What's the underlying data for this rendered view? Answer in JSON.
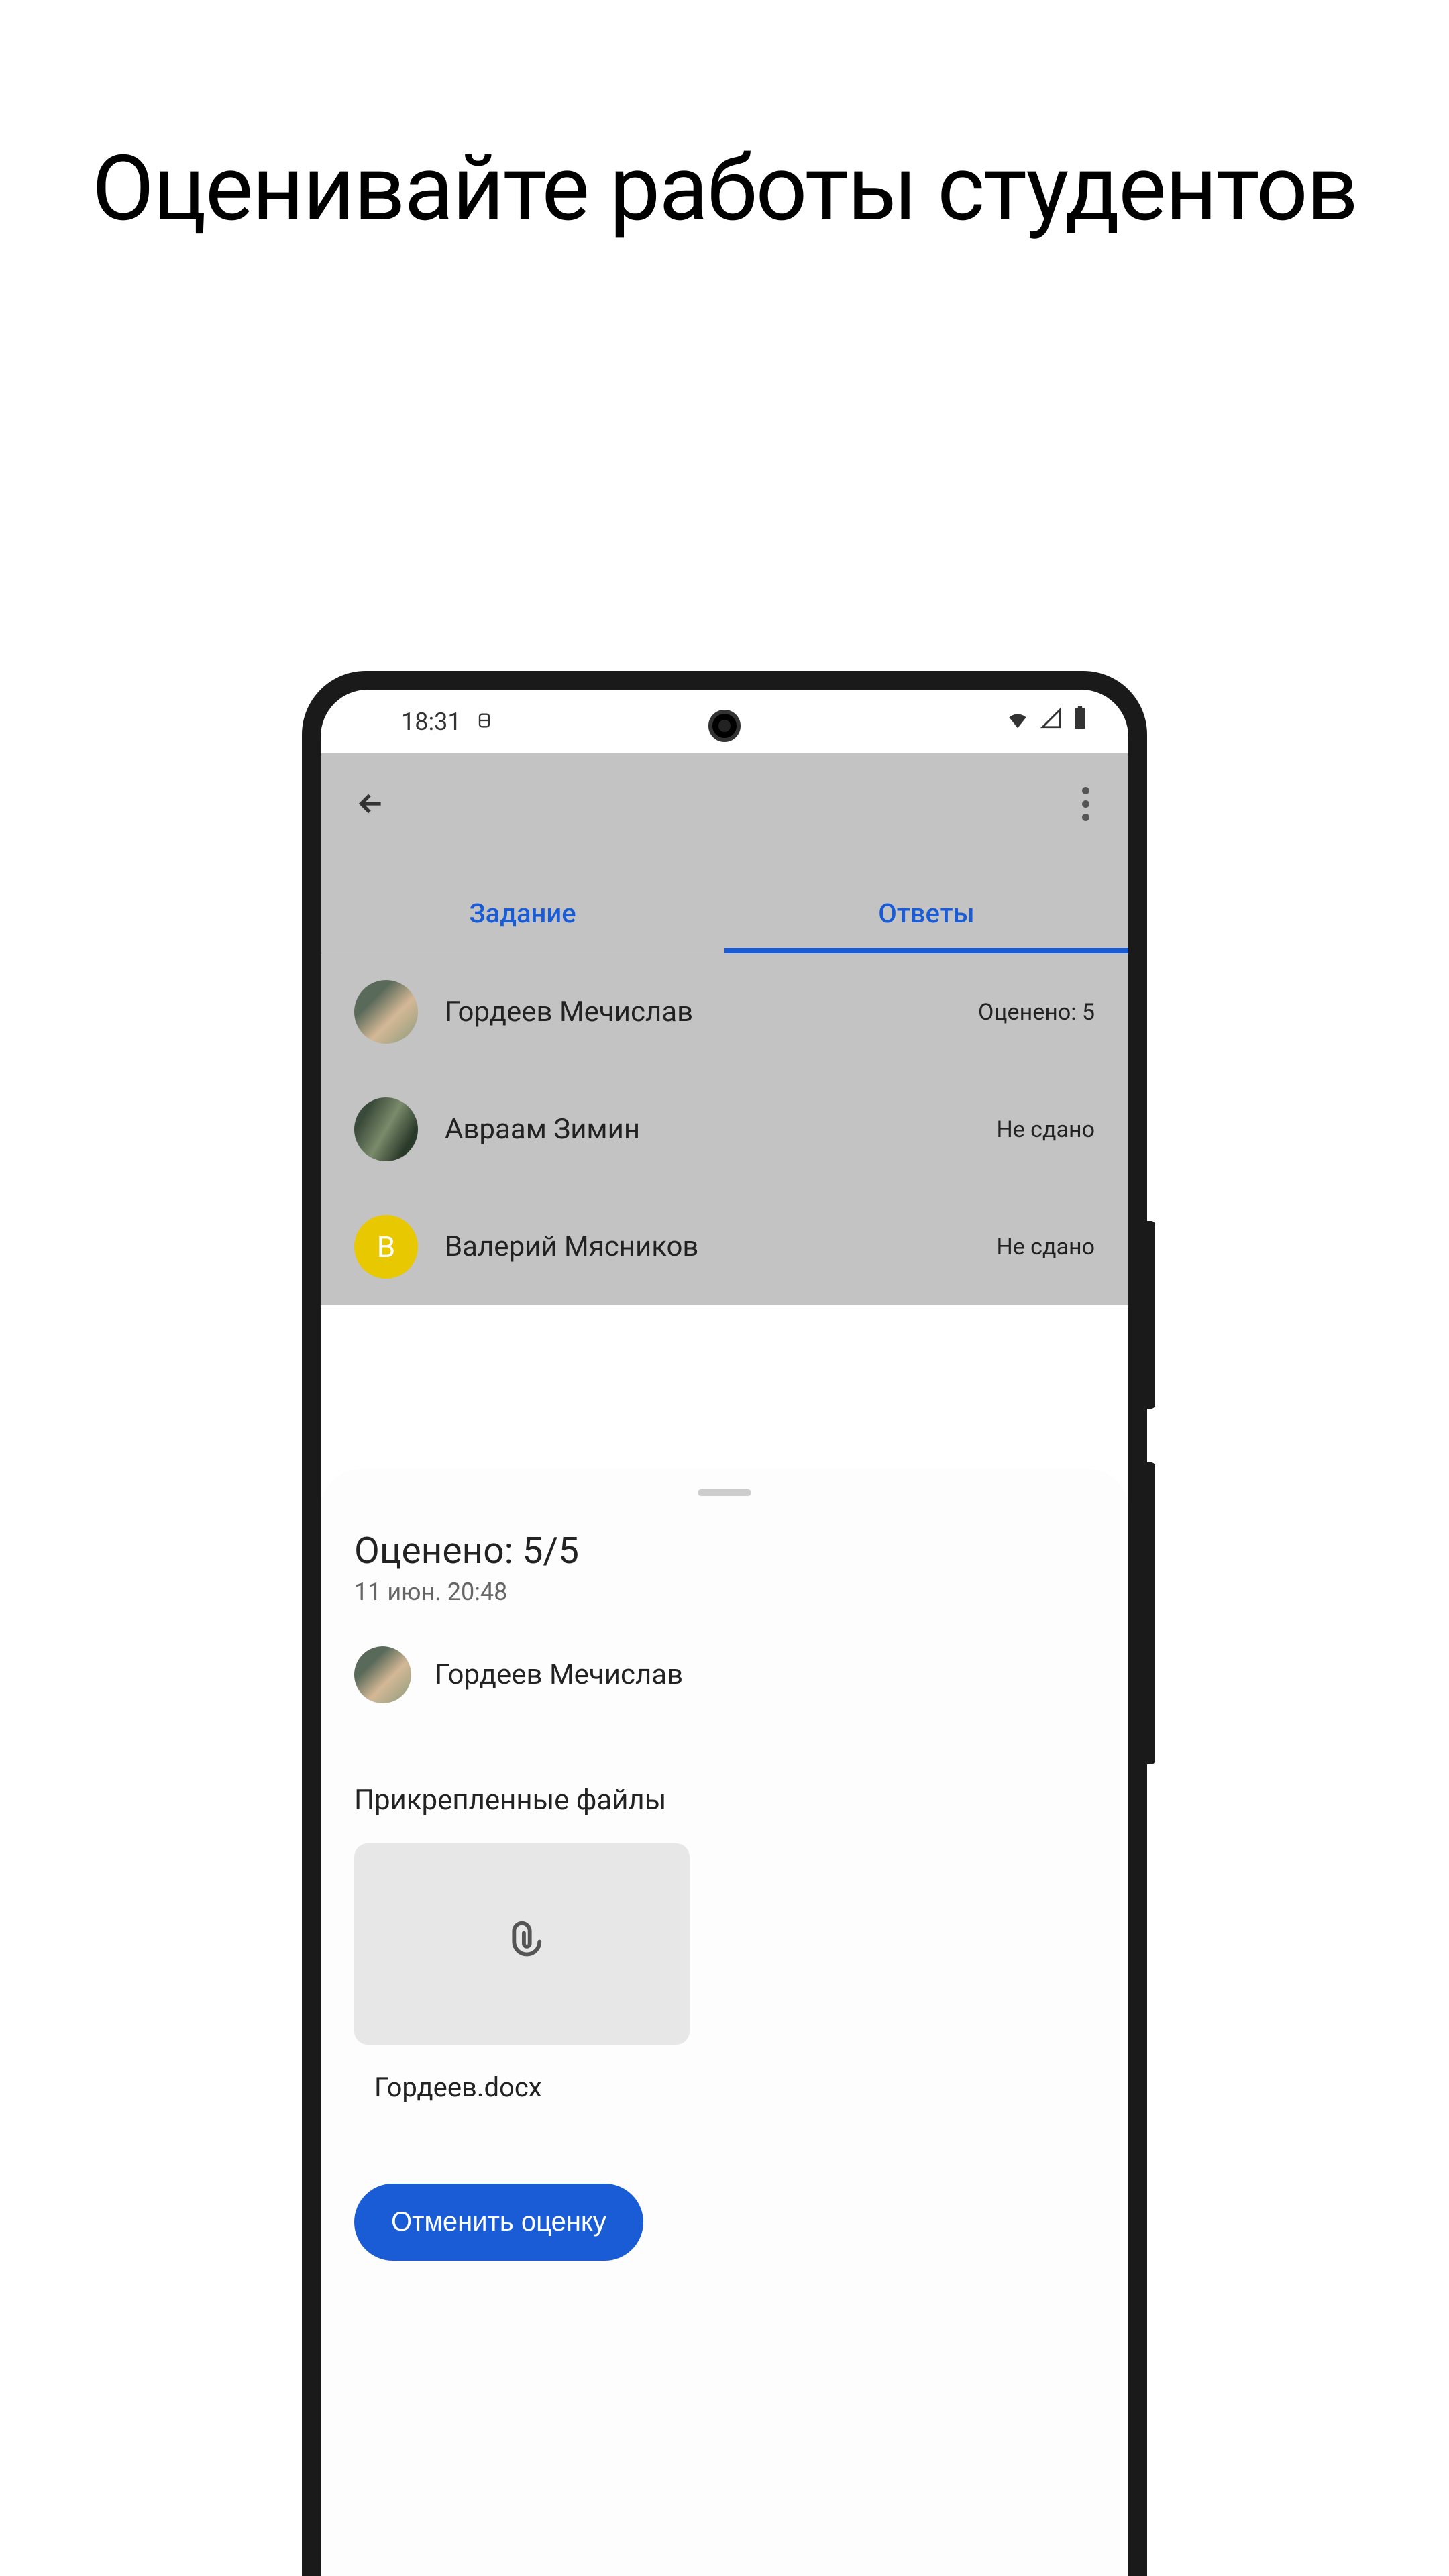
{
  "promo": {
    "title": "Оценивайте работы студентов"
  },
  "statusBar": {
    "time": "18:31"
  },
  "tabs": {
    "assignment": "Задание",
    "answers": "Ответы"
  },
  "students": [
    {
      "name": "Гордеев Мечислав",
      "status": "Оценено: 5",
      "avatarType": "img1"
    },
    {
      "name": "Авраам Зимин",
      "status": "Не сдано",
      "avatarType": "img2"
    },
    {
      "name": "Валерий Мясников",
      "status": "Не сдано",
      "avatarType": "letter",
      "letter": "В"
    }
  ],
  "sheet": {
    "title": "Оценено: 5/5",
    "date": "11 июн. 20:48",
    "studentName": "Гордеев Мечислав",
    "attachmentsLabel": "Прикрепленные файлы",
    "attachmentName": "Гордеев.docx",
    "cancelButton": "Отменить оценку"
  }
}
